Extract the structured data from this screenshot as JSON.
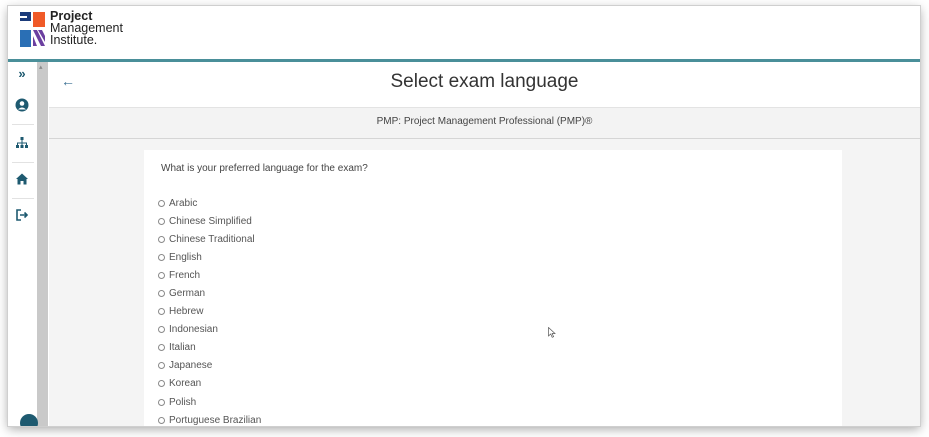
{
  "brand": {
    "line1": "Project",
    "line2": "Management",
    "line3": "Institute."
  },
  "nav": {
    "expand": "»",
    "items": [
      {
        "name": "account-icon"
      },
      {
        "name": "org-chart-icon"
      },
      {
        "name": "home-icon"
      },
      {
        "name": "logout-icon"
      }
    ]
  },
  "page": {
    "back": "←",
    "title": "Select exam language",
    "subtitle": "PMP: Project Management Professional (PMP)®"
  },
  "form": {
    "question": "What is your preferred language for the exam?",
    "options": [
      "Arabic",
      "Chinese Simplified",
      "Chinese Traditional",
      "English",
      "French",
      "German",
      "Hebrew",
      "Indonesian",
      "Italian",
      "Japanese",
      "Korean",
      "Polish",
      "Portuguese Brazilian"
    ]
  },
  "colors": {
    "accent": "#4a8f99",
    "nav": "#1e5a70",
    "logo_orange": "#f05a28",
    "logo_blue": "#2a6fb5",
    "logo_purple": "#6b3fa0"
  }
}
